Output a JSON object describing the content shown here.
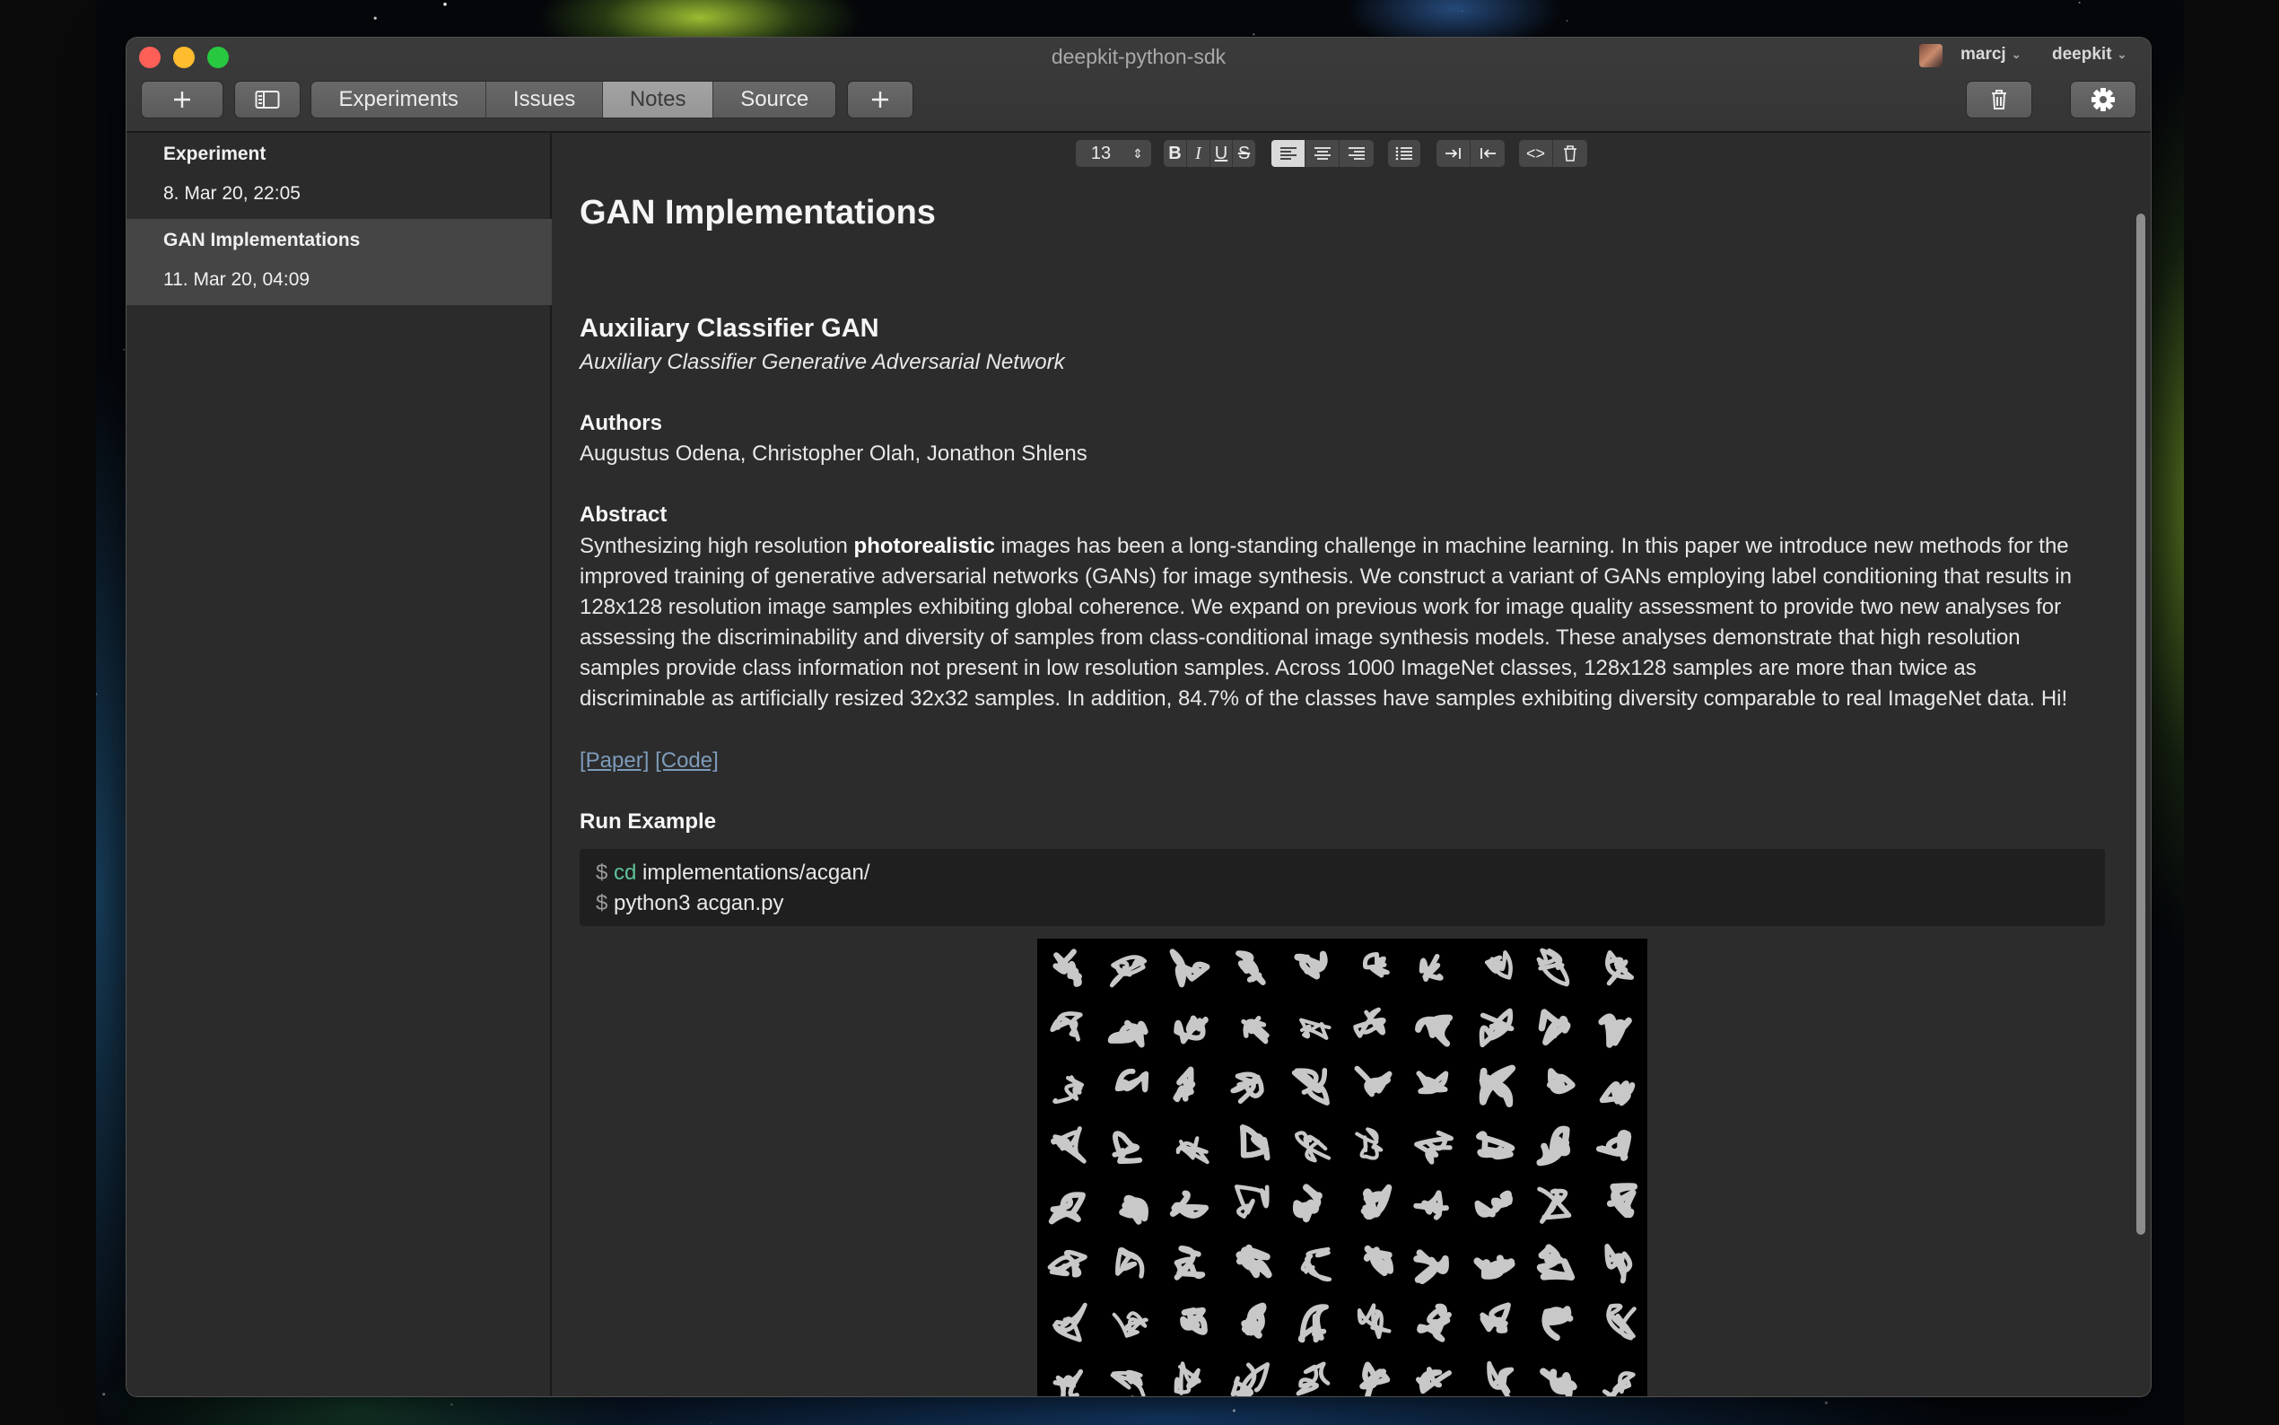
{
  "window": {
    "title": "deepkit-python-sdk",
    "user": "marcj",
    "organization": "deepkit"
  },
  "toolbar": {
    "add_icon": "plus-icon",
    "sidebar_icon": "sidebar-toggle-icon",
    "tabs": [
      {
        "label": "Experiments",
        "active": false
      },
      {
        "label": "Issues",
        "active": false
      },
      {
        "label": "Notes",
        "active": true
      },
      {
        "label": "Source",
        "active": false
      }
    ],
    "add_tab_icon": "plus-icon",
    "delete_icon": "trash-icon",
    "settings_icon": "gear-icon"
  },
  "sidebar": {
    "items": [
      {
        "title": "Experiment",
        "date": "8. Mar 20, 22:05",
        "selected": false
      },
      {
        "title": "GAN Implementations",
        "date": "11. Mar 20, 04:09",
        "selected": true
      }
    ]
  },
  "format_bar": {
    "font_size": "13",
    "bold": "B",
    "italic": "I",
    "underline": "U",
    "strike": "S",
    "code": "<>"
  },
  "note": {
    "title": "GAN Implementations",
    "heading": "Auxiliary Classifier GAN",
    "subtitle": "Auxiliary Classifier Generative Adversarial Network",
    "authors_label": "Authors",
    "authors": "Augustus Odena, Christopher Olah, Jonathon Shlens",
    "abstract_label": "Abstract",
    "abstract_before": "Synthesizing high resolution ",
    "abstract_bold": "photorealistic",
    "abstract_after": " images has been a long-standing challenge in machine learning. In this paper we introduce new methods for the improved training of generative adversarial networks (GANs) for image synthesis. We construct a variant of GANs employing label conditioning that results in 128x128 resolution image samples exhibiting global coherence. We expand on previous work for image quality assessment to provide two new analyses for assessing the discriminability and diversity of samples from class-conditional image synthesis models. These analyses demonstrate that high resolution samples provide class information not present in low resolution samples. Across 1000 ImageNet classes, 128x128 samples are more than twice as discriminable as artificially resized 32x32 samples. In addition, 84.7% of the classes have samples exhibiting diversity comparable to real ImageNet data. Hi!",
    "link_paper": "[Paper]",
    "link_code": "[Code]",
    "run_label": "Run Example",
    "code_lines": [
      {
        "prompt": "$",
        "cmd": "cd",
        "rest": " implementations/acgan/"
      },
      {
        "prompt": "$",
        "cmd": "",
        "rest": "python3 acgan.py"
      }
    ]
  },
  "colors": {
    "window_bg": "#2c2c2c",
    "selection": "#454545",
    "link": "#7d9cbb",
    "code_cmd": "#5fc29a"
  }
}
